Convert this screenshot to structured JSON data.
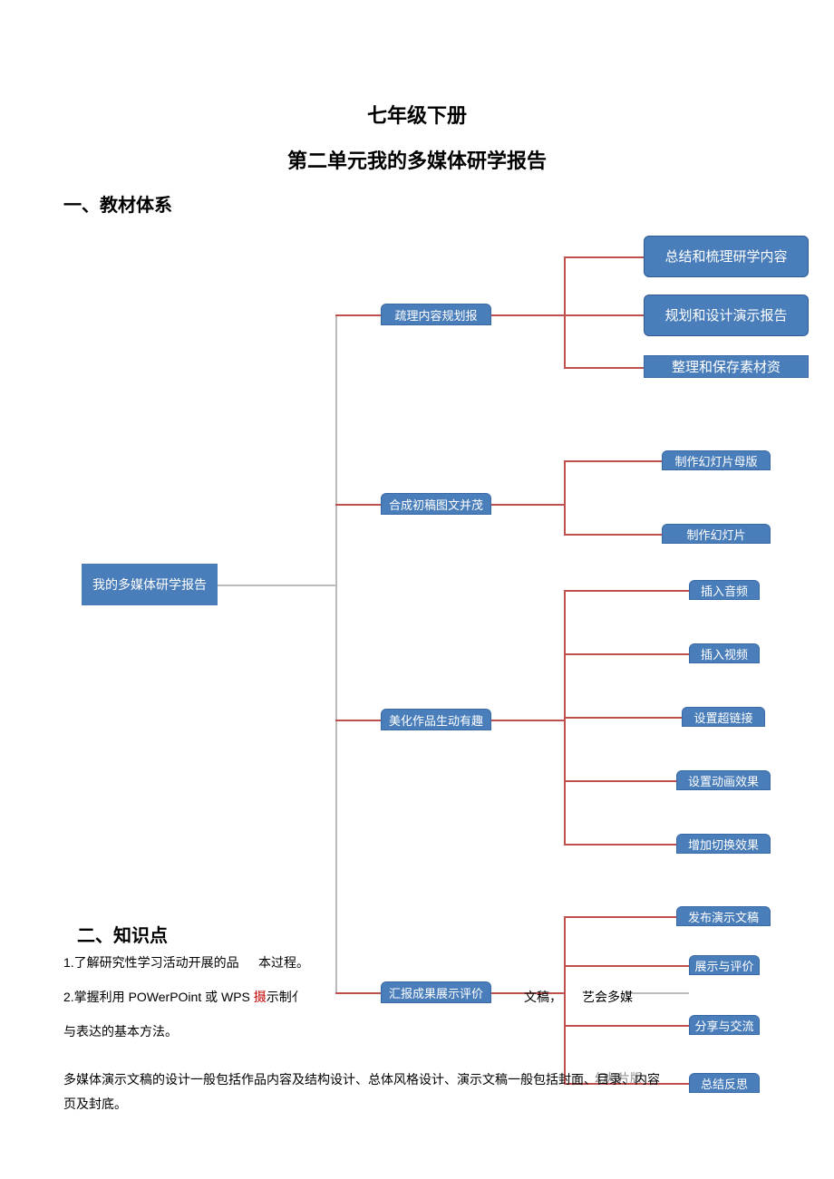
{
  "title": "七年级下册",
  "subtitle": "第二单元我的多媒体研学报告",
  "section_1_heading": "一、教材体系",
  "section_2_heading": "二、知识点",
  "body": {
    "line1a": "1.了解研究性学习活动开展的品",
    "line1b": "本过程。",
    "line2a": "2.掌握利用 POWerPOint 或 WPS ",
    "line2a_red": "摄",
    "line2a_end": "示制亻",
    "line2b": "文稿，",
    "line2c": "艺会多媒",
    "line3": "与表达的基本方法。",
    "para2": "多媒体演示文稿的设计一般包括作品内容及结构设计、总体风格设计、演示文稿一般包括封面、目录、内容页及封底。"
  },
  "faint_label": "幻灯片版",
  "diagram": {
    "root": "我的多媒体研学报告",
    "mid": {
      "m1": "疏理内容规划报",
      "m2": "合成初稿图文并茂",
      "m3": "美化作品生动有趣",
      "m4": "汇报成果展示评价"
    },
    "level1a": {
      "n1": "总结和梳理研学内容",
      "n2": "规划和设计演示报告",
      "n3": "整理和保存素材资"
    },
    "level1b": {
      "n1": "制作幻灯片母版",
      "n2": "制作幻灯片"
    },
    "level1c": {
      "n1": "插入音频",
      "n2": "插入视频",
      "n3": "设置超链接",
      "n4": "设置动画效果",
      "n5": "增加切换效果"
    },
    "level1d": {
      "n1": "发布演示文稿",
      "n2": "展示与评价",
      "n3": "分享与交流",
      "n4": "总结反思"
    }
  },
  "chart_data": {
    "type": "tree",
    "root": "我的多媒体研学报告",
    "children": [
      {
        "label": "疏理内容规划报",
        "children": [
          {
            "label": "总结和梳理研学内容"
          },
          {
            "label": "规划和设计演示报告"
          },
          {
            "label": "整理和保存素材资"
          }
        ]
      },
      {
        "label": "合成初稿图文并茂",
        "children": [
          {
            "label": "制作幻灯片母版"
          },
          {
            "label": "制作幻灯片"
          }
        ]
      },
      {
        "label": "美化作品生动有趣",
        "children": [
          {
            "label": "插入音频"
          },
          {
            "label": "插入视频"
          },
          {
            "label": "设置超链接"
          },
          {
            "label": "设置动画效果"
          },
          {
            "label": "增加切换效果"
          }
        ]
      },
      {
        "label": "汇报成果展示评价",
        "children": [
          {
            "label": "发布演示文稿"
          },
          {
            "label": "展示与评价"
          },
          {
            "label": "分享与交流"
          },
          {
            "label": "总结反思"
          }
        ]
      }
    ]
  }
}
